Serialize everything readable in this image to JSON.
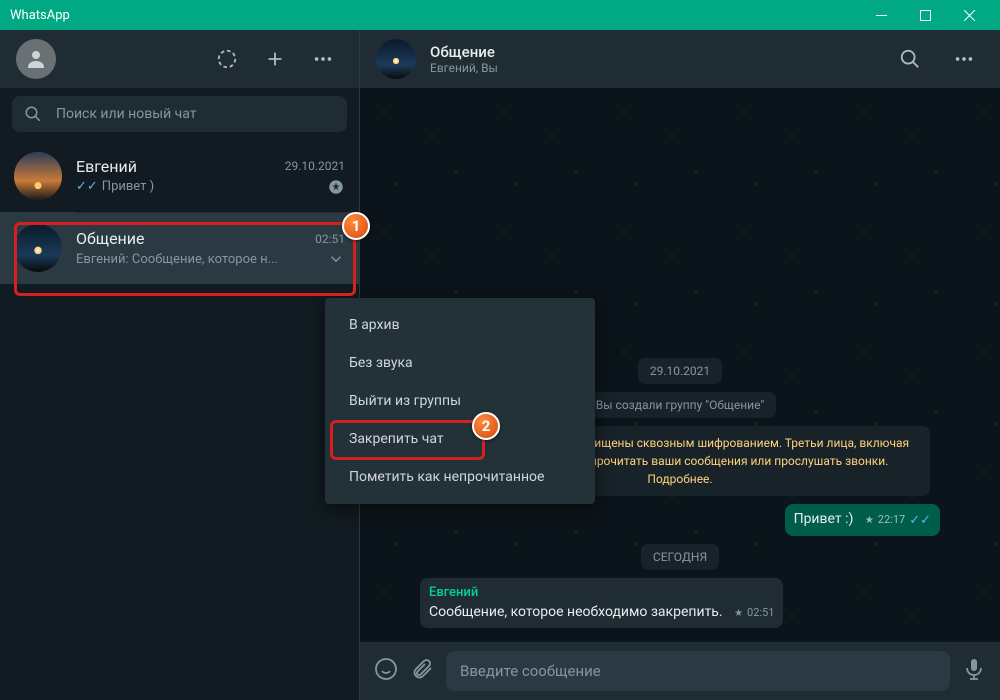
{
  "titlebar": {
    "app_name": "WhatsApp"
  },
  "sidebar": {
    "search_placeholder": "Поиск или новый чат",
    "chats": [
      {
        "name": "Евгений",
        "time": "29.10.2021",
        "preview": "Привет )",
        "read": true,
        "pinned": true
      },
      {
        "name": "Общение",
        "time": "02:51",
        "preview": "Евгений: Сообщение, которое н..."
      }
    ]
  },
  "header": {
    "title": "Общение",
    "subtitle": "Евгений, Вы"
  },
  "context_menu": {
    "items": [
      "В архив",
      "Без звука",
      "Выйти из группы",
      "Закрепить чат",
      "Пометить как непрочитанное"
    ]
  },
  "annotations": {
    "badge1": "1",
    "badge2": "2"
  },
  "conversation": {
    "date1": "29.10.2021",
    "sys_created": "Вы создали группу \"Общение\"",
    "sys_encrypt": "Сообщения и звонки защищены сквозным шифрованием. Третьи лица, включая WhatsApp, не смогут прочитать ваши сообщения или прослушать звонки. Подробнее.",
    "out1": {
      "text": "Привет :)",
      "time": "22:17"
    },
    "date2": "СЕГОДНЯ",
    "in1": {
      "sender": "Евгений",
      "text": "Сообщение, которое необходимо закрепить.",
      "time": "02:51"
    }
  },
  "composer": {
    "placeholder": "Введите сообщение"
  }
}
